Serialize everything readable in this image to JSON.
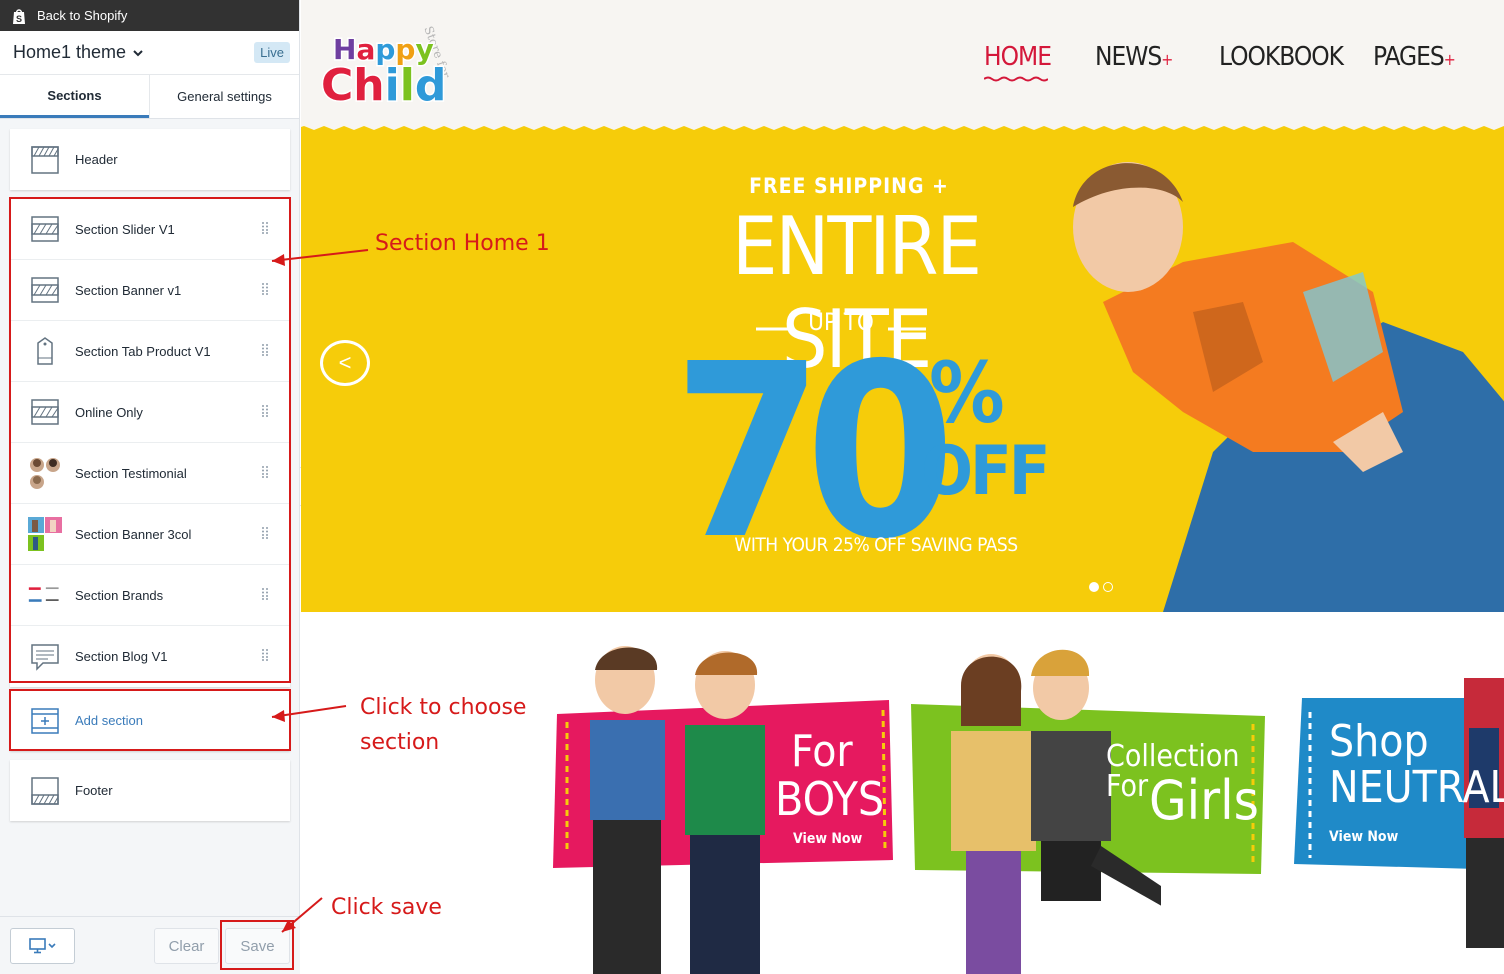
{
  "sidebar": {
    "back_label": "Back to Shopify",
    "theme_name": "Home1 theme",
    "live_badge": "Live",
    "tabs": [
      {
        "label": "Sections",
        "active": true
      },
      {
        "label": "General settings",
        "active": false
      }
    ],
    "header_item": {
      "label": "Header",
      "icon": "header-layout-icon"
    },
    "sections": [
      {
        "label": "Section Slider V1",
        "icon": "slider-layout-icon"
      },
      {
        "label": "Section Banner v1",
        "icon": "banner-layout-icon"
      },
      {
        "label": "Section Tab Product V1",
        "icon": "product-tag-icon"
      },
      {
        "label": "Online Only",
        "icon": "banner-layout-icon"
      },
      {
        "label": "Section Testimonial",
        "icon": "testimonial-avatars-icon"
      },
      {
        "label": "Section Banner 3col",
        "icon": "banner-thumbnail-icon"
      },
      {
        "label": "Section Brands",
        "icon": "brands-thumbnail-icon"
      },
      {
        "label": "Section Blog V1",
        "icon": "blog-comment-icon"
      }
    ],
    "add_section_label": "Add section",
    "footer_item": {
      "label": "Footer",
      "icon": "footer-layout-icon"
    },
    "bottom": {
      "device_icon": "desktop-icon",
      "clear_label": "Clear",
      "save_label": "Save"
    }
  },
  "annotations": {
    "section_home": "Section Home 1",
    "choose_line1": "Click to choose",
    "choose_line2": "section",
    "click_save": "Click save",
    "color": "#d61a1a"
  },
  "preview": {
    "logo": {
      "line1": "Happy",
      "line2": "Child",
      "tagline": "Store for"
    },
    "nav": [
      {
        "label": "HOME",
        "active": true,
        "has_sub": false
      },
      {
        "label": "NEWS",
        "active": false,
        "has_sub": true
      },
      {
        "label": "LOOKBOOK",
        "active": false,
        "has_sub": false
      },
      {
        "label": "PAGES",
        "active": false,
        "has_sub": true
      }
    ],
    "nav_plus": "+",
    "slider": {
      "line1": "FREE SHIPPING +",
      "line2": "ENTIRE SITE",
      "line3": "UP TO",
      "big_number": "70",
      "percent": "%",
      "off": "OFF",
      "footer": "WITH YOUR 25% OFF SAVING PASS",
      "prev_arrow": "<",
      "background": "#f6cc0a",
      "accent": "#2f9ad9",
      "slides": 2,
      "active_slide": 1
    },
    "banners": [
      {
        "line1": "For",
        "line2": "BOYS",
        "cta": "View Now",
        "color": "#e6195f"
      },
      {
        "line1": "Collection For",
        "line2": "Girls",
        "cta": "",
        "color": "#7cc21f"
      },
      {
        "line1": "Shop",
        "line2": "NEUTRAL",
        "cta": "View Now",
        "color": "#1f8ac8"
      }
    ]
  }
}
